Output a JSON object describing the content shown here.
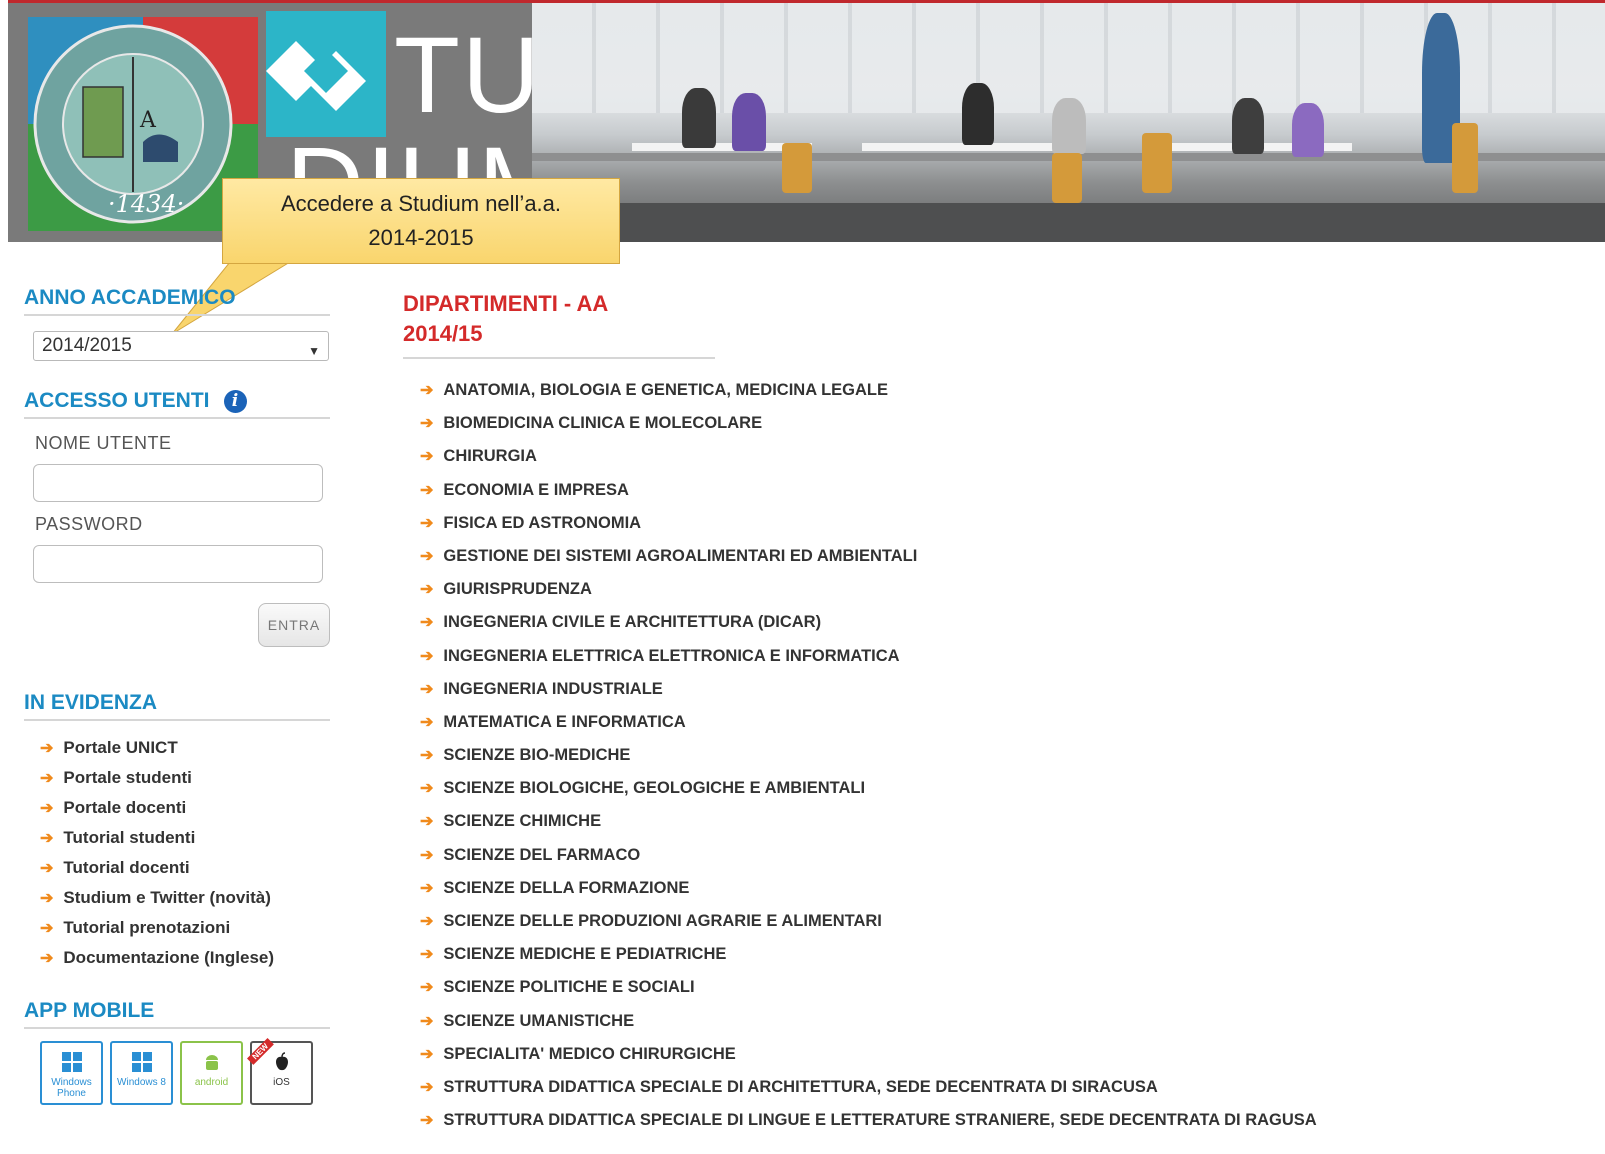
{
  "callout": {
    "line1": "Accedere a Studium nell’a.a.",
    "line2": "2014-2015"
  },
  "sidebar": {
    "anno_title": "ANNO ACCADEMICO",
    "anno_selected": "2014/2015",
    "accesso_title": "ACCESSO UTENTI",
    "username_label": "NOME UTENTE",
    "password_label": "PASSWORD",
    "login_button": "ENTRA",
    "evidenza_title": "IN EVIDENZA",
    "evidenza_items": [
      "Portale UNICT",
      "Portale studenti",
      "Portale docenti",
      "Tutorial studenti",
      "Tutorial docenti",
      "Studium e Twitter (novità)",
      "Tutorial prenotazioni",
      "Documentazione (Inglese)"
    ],
    "app_title": "APP MOBILE",
    "apps": [
      {
        "label": "Windows Phone",
        "icon": "windows-phone-icon"
      },
      {
        "label": "Windows 8",
        "icon": "windows8-icon"
      },
      {
        "label": "android",
        "icon": "android-icon"
      },
      {
        "label": "iOS",
        "icon": "apple-icon",
        "badge": "NEW"
      }
    ]
  },
  "main": {
    "title_line1": "DIPARTIMENTI - AA",
    "title_line2": "2014/15",
    "departments": [
      "ANATOMIA, BIOLOGIA E GENETICA, MEDICINA LEGALE",
      "BIOMEDICINA CLINICA E MOLECOLARE",
      "CHIRURGIA",
      "ECONOMIA E IMPRESA",
      "FISICA ED ASTRONOMIA",
      "GESTIONE DEI SISTEMI AGROALIMENTARI ED AMBIENTALI",
      "GIURISPRUDENZA",
      "INGEGNERIA CIVILE E ARCHITETTURA (DICAR)",
      "INGEGNERIA ELETTRICA ELETTRONICA E INFORMATICA",
      "INGEGNERIA INDUSTRIALE",
      "MATEMATICA E INFORMATICA",
      "SCIENZE BIO-MEDICHE",
      "SCIENZE BIOLOGICHE, GEOLOGICHE E AMBIENTALI",
      "SCIENZE CHIMICHE",
      "SCIENZE DEL FARMACO",
      "SCIENZE DELLA FORMAZIONE",
      "SCIENZE DELLE PRODUZIONI AGRARIE E ALIMENTARI",
      "SCIENZE MEDICHE E PEDIATRICHE",
      "SCIENZE POLITICHE E SOCIALI",
      "SCIENZE UMANISTICHE",
      "SPECIALITA' MEDICO CHIRURGICHE",
      "STRUTTURA DIDATTICA SPECIALE DI ARCHITETTURA, SEDE DECENTRATA DI SIRACUSA",
      "STRUTTURA DIDATTICA SPECIALE DI LINGUE E LETTERATURE STRANIERE, SEDE DECENTRATA DI RAGUSA"
    ]
  },
  "colors": {
    "accent_blue": "#1b8ac3",
    "accent_red": "#d42a2a",
    "arrow_orange": "#f08a1c"
  }
}
